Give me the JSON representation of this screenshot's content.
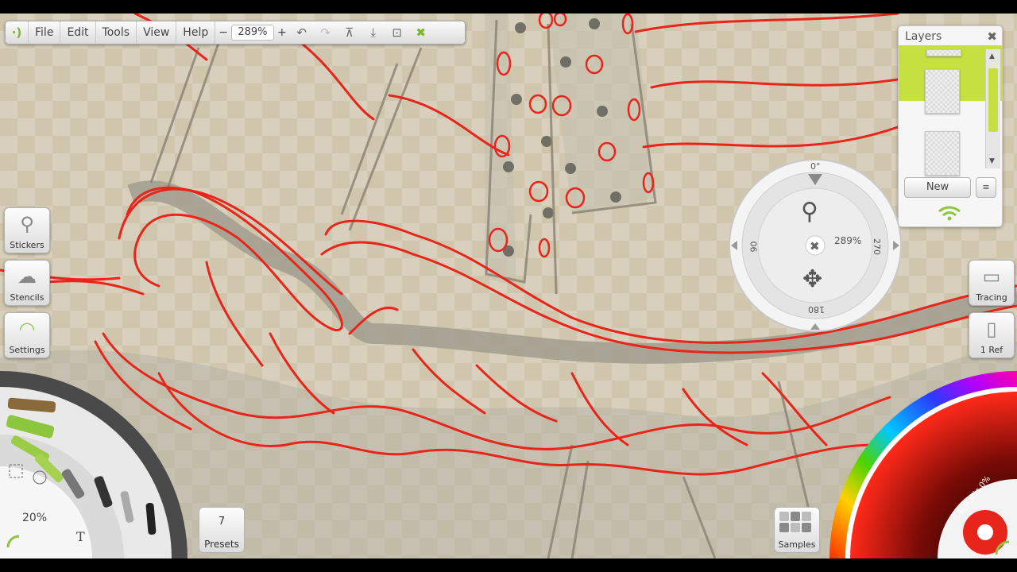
{
  "toolbar": {
    "logo": "·)",
    "menus": [
      "File",
      "Edit",
      "Tools",
      "View",
      "Help"
    ],
    "zoom_minus": "−",
    "zoom_value": "289%",
    "zoom_plus": "+",
    "icons": [
      "undo-icon",
      "redo-icon",
      "tracing-paper-icon",
      "import-icon",
      "export-icon",
      "fullscreen-icon"
    ]
  },
  "layers": {
    "title": "Layers",
    "close": "✖",
    "new_label": "New",
    "menu_label": "≡"
  },
  "side_left": {
    "stickers": "Stickers",
    "stencils": "Stencils",
    "settings": "Settings"
  },
  "side_right": {
    "tracing": "Tracing",
    "ref": "1 Ref"
  },
  "dial": {
    "top": "0°",
    "right": "270",
    "bottom": "180",
    "left": "90",
    "zoom": "289%"
  },
  "presets": {
    "count": "7",
    "label": "Presets"
  },
  "samples": {
    "label": "Samples"
  },
  "wheel": {
    "size": "20%"
  },
  "color_wheel": {
    "metallic": "Metallic 0%",
    "current_color": "#e8251b"
  },
  "colors": {
    "accent_green": "#c6e042",
    "stroke_red": "#e8251b"
  }
}
